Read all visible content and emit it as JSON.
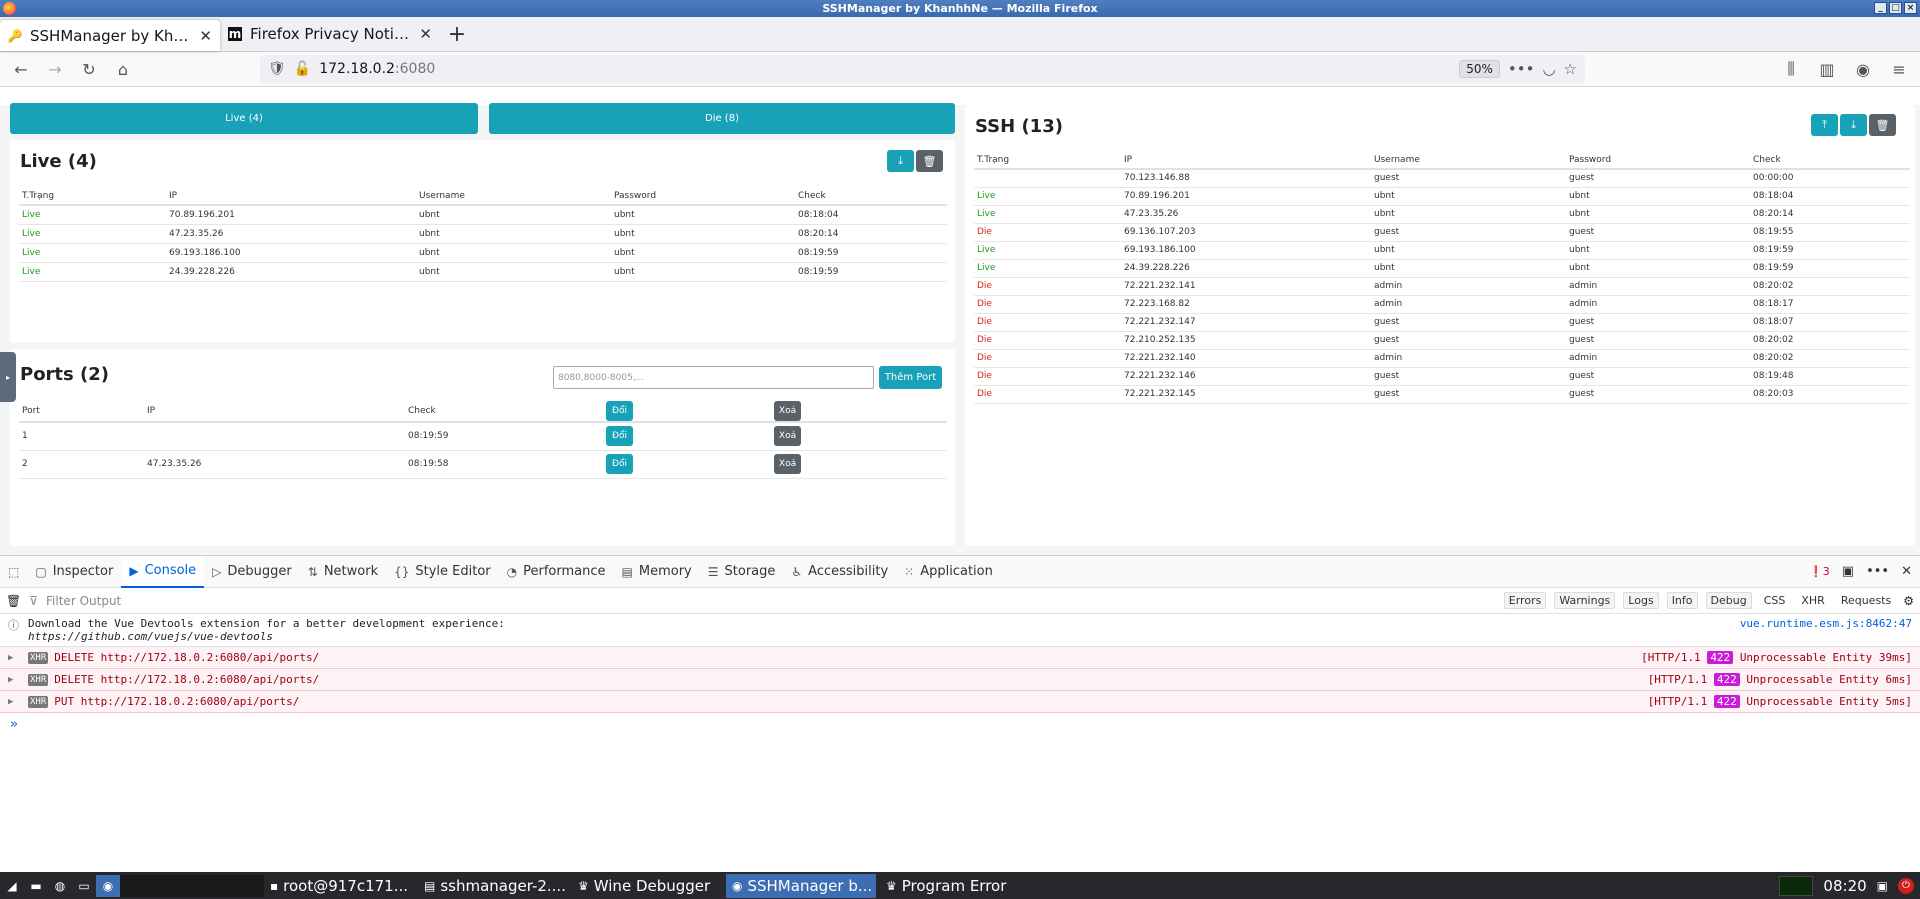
{
  "window": {
    "title": "SSHManager by KhanhhNe — Mozilla Firefox"
  },
  "tabs": [
    {
      "label": "SSHManager by KhanhhNe",
      "active": true
    },
    {
      "label": "Firefox Privacy Notice —",
      "active": false
    }
  ],
  "url": {
    "host": "172.18.0.2",
    "port": ":6080",
    "zoom": "50%"
  },
  "toggle": {
    "live": "Live (4)",
    "die": "Die (8)"
  },
  "live": {
    "title": "Live (4)",
    "columns": [
      "T.Trạng",
      "IP",
      "Username",
      "Password",
      "Check"
    ],
    "rows": [
      [
        "Live",
        "70.89.196.201",
        "ubnt",
        "ubnt",
        "08:18:04"
      ],
      [
        "Live",
        "47.23.35.26",
        "ubnt",
        "ubnt",
        "08:20:14"
      ],
      [
        "Live",
        "69.193.186.100",
        "ubnt",
        "ubnt",
        "08:19:59"
      ],
      [
        "Live",
        "24.39.228.226",
        "ubnt",
        "ubnt",
        "08:19:59"
      ]
    ]
  },
  "ports": {
    "title": "Ports (2)",
    "placeholder": "8080,8000-8005,...",
    "add_label": "Thêm Port",
    "columns": [
      "Port",
      "IP",
      "Check"
    ],
    "change_label": "Đổi",
    "delete_label": "Xoá",
    "rows": [
      [
        "1",
        "",
        "08:19:59"
      ],
      [
        "2",
        "47.23.35.26",
        "08:19:58"
      ]
    ]
  },
  "ssh": {
    "title": "SSH (13)",
    "columns": [
      "T.Trạng",
      "IP",
      "Username",
      "Password",
      "Check"
    ],
    "rows": [
      [
        "",
        "70.123.146.88",
        "guest",
        "guest",
        "00:00:00"
      ],
      [
        "Live",
        "70.89.196.201",
        "ubnt",
        "ubnt",
        "08:18:04"
      ],
      [
        "Live",
        "47.23.35.26",
        "ubnt",
        "ubnt",
        "08:20:14"
      ],
      [
        "Die",
        "69.136.107.203",
        "guest",
        "guest",
        "08:19:55"
      ],
      [
        "Live",
        "69.193.186.100",
        "ubnt",
        "ubnt",
        "08:19:59"
      ],
      [
        "Live",
        "24.39.228.226",
        "ubnt",
        "ubnt",
        "08:19:59"
      ],
      [
        "Die",
        "72.221.232.141",
        "admin",
        "admin",
        "08:20:02"
      ],
      [
        "Die",
        "72.223.168.82",
        "admin",
        "admin",
        "08:18:17"
      ],
      [
        "Die",
        "72.221.232.147",
        "guest",
        "guest",
        "08:18:07"
      ],
      [
        "Die",
        "72.210.252.135",
        "guest",
        "guest",
        "08:20:02"
      ],
      [
        "Die",
        "72.221.232.140",
        "admin",
        "admin",
        "08:20:02"
      ],
      [
        "Die",
        "72.221.232.146",
        "guest",
        "guest",
        "08:19:48"
      ],
      [
        "Die",
        "72.221.232.145",
        "guest",
        "guest",
        "08:20:03"
      ]
    ]
  },
  "devtools": {
    "tabs": [
      "Inspector",
      "Console",
      "Debugger",
      "Network",
      "Style Editor",
      "Performance",
      "Memory",
      "Storage",
      "Accessibility",
      "Application"
    ],
    "error_count": "3",
    "filter_placeholder": "Filter Output",
    "filters": [
      "Errors",
      "Warnings",
      "Logs",
      "Info",
      "Debug"
    ],
    "filters2": [
      "CSS",
      "XHR",
      "Requests"
    ],
    "info": {
      "line1": "Download the Vue Devtools extension for a better development experience:",
      "line2": "https://github.com/vuejs/vue-devtools",
      "source": "vue.runtime.esm.js:8462:47"
    },
    "errors": [
      {
        "method": "DELETE",
        "url": "http://172.18.0.2:6080/api/ports/",
        "proto": "[HTTP/1.1",
        "code": "422",
        "status": "Unprocessable Entity 39ms]"
      },
      {
        "method": "DELETE",
        "url": "http://172.18.0.2:6080/api/ports/",
        "proto": "[HTTP/1.1",
        "code": "422",
        "status": "Unprocessable Entity 6ms]"
      },
      {
        "method": "PUT",
        "url": "http://172.18.0.2:6080/api/ports/",
        "proto": "[HTTP/1.1",
        "code": "422",
        "status": "Unprocessable Entity 5ms]"
      }
    ],
    "xhr_label": "XHR",
    "prompt": "»"
  },
  "taskbar": {
    "items": [
      {
        "label": "root@917c171...",
        "icon": "terminal-icon"
      },
      {
        "label": "sshmanager-2....",
        "icon": "folder-icon"
      },
      {
        "label": "Wine Debugger",
        "icon": "wine-icon"
      },
      {
        "label": "SSHManager b...",
        "icon": "firefox-icon",
        "active": true
      },
      {
        "label": "Program Error",
        "icon": "wine-icon"
      }
    ],
    "clock": "08:20"
  }
}
